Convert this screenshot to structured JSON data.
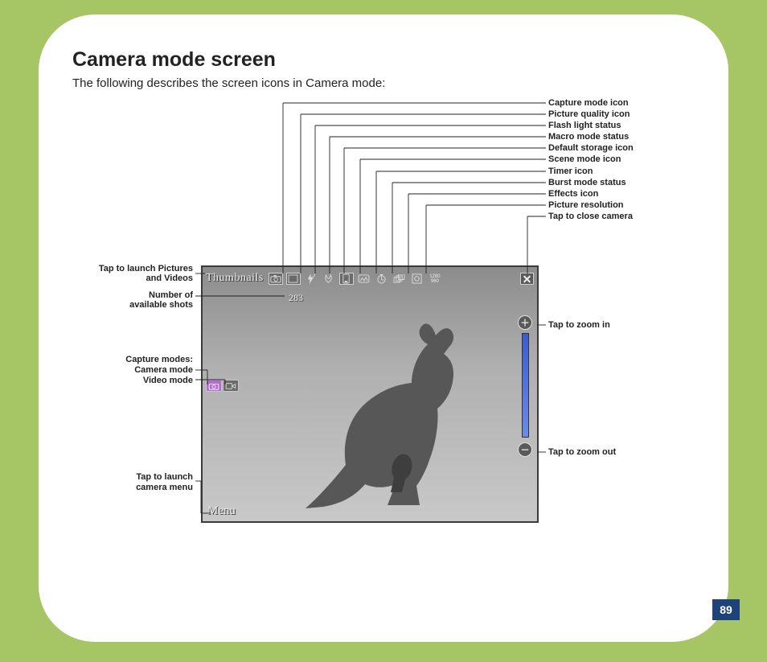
{
  "title": "Camera mode screen",
  "subtitle": "The following describes the screen icons in Camera mode:",
  "page_number": "89",
  "screenshot": {
    "thumbnails_label": "Thumbnails",
    "shots_remaining": "283",
    "menu_label": "Menu",
    "resolution_top": "1280",
    "resolution_bottom": "960"
  },
  "callouts_right": [
    "Capture mode icon",
    "Picture quality icon",
    "Flash light status",
    "Macro mode status",
    "Default storage icon",
    "Scene mode icon",
    "Timer icon",
    "Burst mode status",
    "Effects icon",
    "Picture resolution",
    "Tap to close camera"
  ],
  "callouts_zoom": {
    "in": "Tap to zoom in",
    "out": "Tap to zoom out"
  },
  "callouts_left": {
    "thumbnails_l1": "Tap to launch Pictures",
    "thumbnails_l2": "and Videos",
    "shots_l1": "Number of",
    "shots_l2": "available shots",
    "modes_l1": "Capture modes:",
    "modes_l2": "Camera mode",
    "modes_l3": "Video mode",
    "menu_l1": "Tap to launch",
    "menu_l2": "camera menu"
  }
}
